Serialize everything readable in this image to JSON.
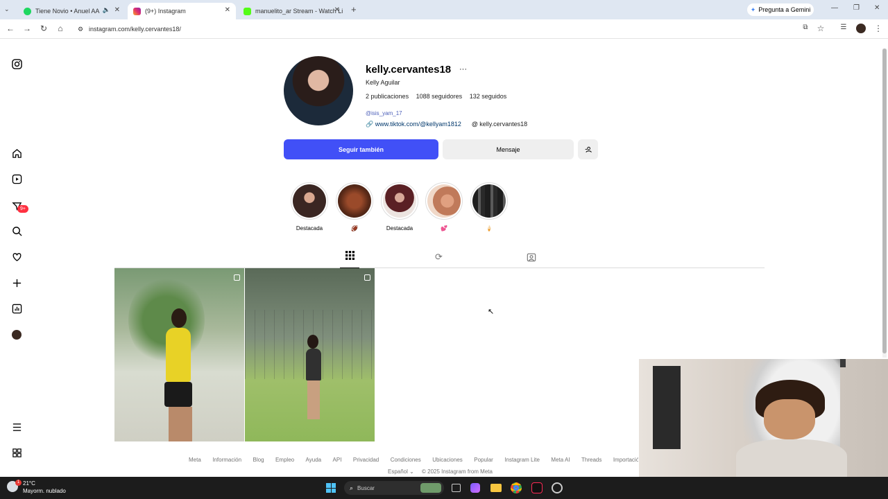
{
  "browser": {
    "tabs": [
      {
        "title": "Tiene Novio • Anuel AA",
        "color": "#1ed760",
        "active": false
      },
      {
        "title": "(9+) Instagram",
        "color": "#e1306c",
        "active": true
      },
      {
        "title": "manuelito_ar Stream - Watch Li",
        "color": "#53fc18",
        "active": false
      }
    ],
    "new_tab": "+",
    "gemini_label": "Pregunta a Gemini",
    "url": "instagram.com/kelly.cervantes18/"
  },
  "sidebar": {
    "notifications_badge": "9+"
  },
  "profile": {
    "username": "kelly.cervantes18",
    "more": "···",
    "full_name": "Kelly Aguilar",
    "posts_count": "2",
    "posts_label": "publicaciones",
    "followers_count": "1088",
    "followers_label": "seguidores",
    "following_count": "132",
    "following_label": "seguidos",
    "mention": "@isis_yam_17",
    "link": "www.tiktok.com/@kellyam1812",
    "threads_handle": "kelly.cervantes18",
    "follow_back_label": "Seguir también",
    "message_label": "Mensaje"
  },
  "highlights": [
    {
      "label": "Destacada",
      "color": "#6b4a3a"
    },
    {
      "label": "🏈",
      "color": "#7a3a22"
    },
    {
      "label": "Destacada",
      "color": "#5a2a2a"
    },
    {
      "label": "💕",
      "color": "#c8876a"
    },
    {
      "label": "🍦",
      "color": "#2c2c2c"
    }
  ],
  "footer": {
    "links": [
      "Meta",
      "Información",
      "Blog",
      "Empleo",
      "Ayuda",
      "API",
      "Privacidad",
      "Condiciones",
      "Ubicaciones",
      "Popular",
      "Instagram Lite",
      "Meta AI",
      "Threads",
      "Importación de contactos y no us"
    ],
    "language": "Español",
    "copyright": "© 2025 Instagram from Meta"
  },
  "taskbar": {
    "weather_temp": "21°C",
    "weather_desc": "Mayorm. nublado",
    "weather_badge": "1",
    "search_placeholder": "Buscar"
  }
}
